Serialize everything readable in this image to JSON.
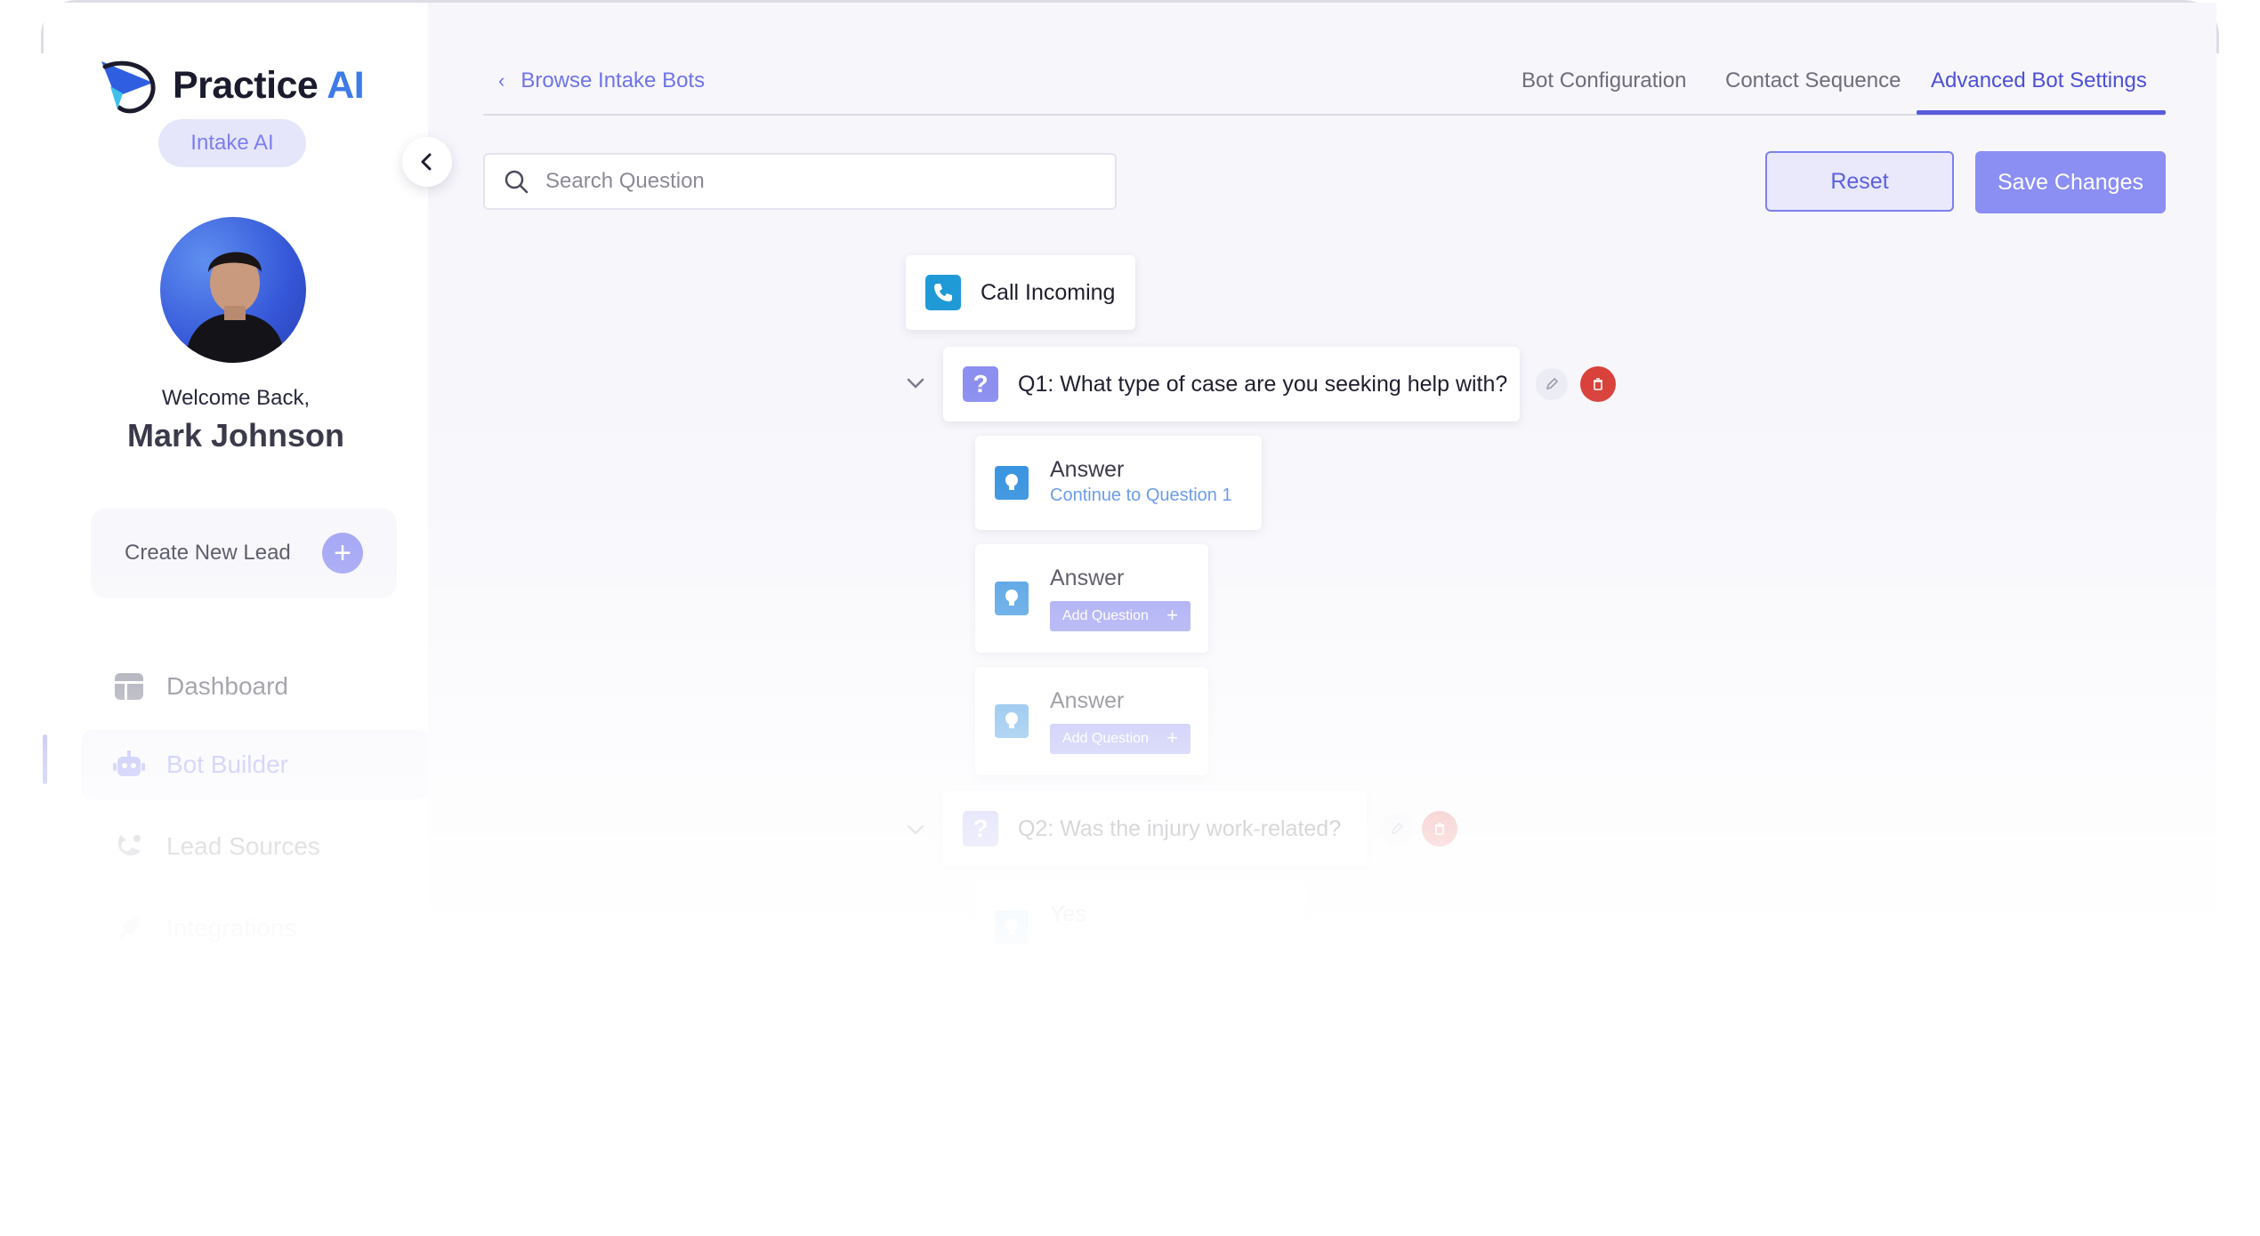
{
  "app": {
    "logo_text": "Practice",
    "logo_text_accent": "AI",
    "product_badge": "Intake AI"
  },
  "sidebar": {
    "welcome": "Welcome Back,",
    "user_name": "Mark Johnson",
    "create_lead_label": "Create New Lead",
    "items": [
      {
        "label": "Dashboard",
        "icon": "dashboard-icon"
      },
      {
        "label": "Bot Builder",
        "icon": "robot-icon",
        "active": true
      },
      {
        "label": "Lead Sources",
        "icon": "lead-sources-icon"
      },
      {
        "label": "Integrations",
        "icon": "plug-icon"
      }
    ]
  },
  "header": {
    "breadcrumb": "Browse Intake Bots",
    "tabs": [
      {
        "label": "Bot Configuration"
      },
      {
        "label": "Contact Sequence"
      },
      {
        "label": "Advanced Bot Settings",
        "active": true
      }
    ]
  },
  "toolbar": {
    "search_placeholder": "Search Question",
    "reset_label": "Reset",
    "save_label": "Save Changes"
  },
  "flow": {
    "start_label": "Call Incoming",
    "questions": [
      {
        "label": "Q1: What type of case are you seeking help with?",
        "answers": [
          {
            "title": "Answer",
            "sub": "Continue to Question 1"
          },
          {
            "title": "Answer",
            "action": "Add Question"
          },
          {
            "title": "Answer",
            "action": "Add Question"
          }
        ]
      },
      {
        "label": "Q2: Was the injury work-related?",
        "answers": [
          {
            "title": "Yes"
          }
        ]
      }
    ]
  },
  "colors": {
    "accent": "#6f72ef",
    "primary_button": "#8b8ef3",
    "delete": "#d9413b",
    "call_icon": "#1f9ad6",
    "answer_icon": "#1f86dc"
  }
}
